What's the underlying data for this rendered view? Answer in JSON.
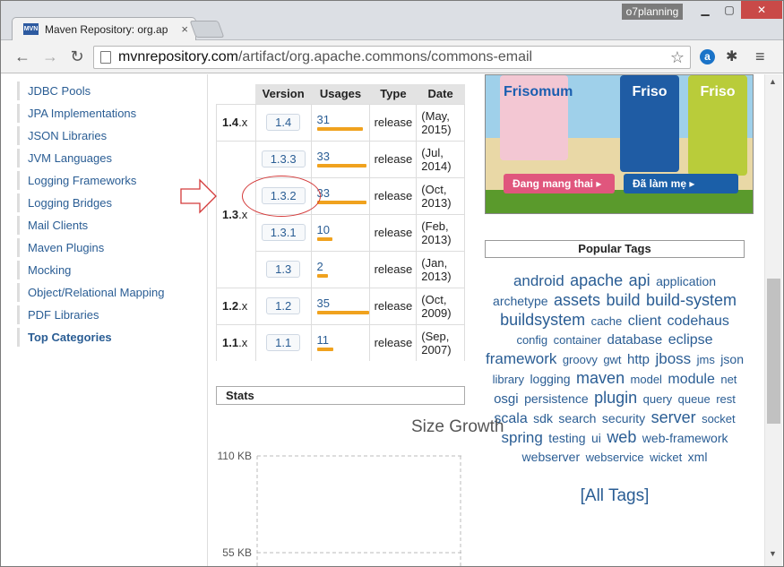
{
  "browser": {
    "tab_title": "Maven Repository: org.ap",
    "favicon_text": "MVN",
    "close_glyph": "×",
    "user_label": "o7planning",
    "url_host": "mvnrepository.com",
    "url_path": "/artifact/org.apache.commons/commons-email"
  },
  "sidebar": {
    "items": [
      "JDBC Pools",
      "JPA Implementations",
      "JSON Libraries",
      "JVM Languages",
      "Logging Frameworks",
      "Logging Bridges",
      "Mail Clients",
      "Maven Plugins",
      "Mocking",
      "Object/Relational Mapping",
      "PDF Libraries",
      "Top Categories"
    ]
  },
  "versions": {
    "headers": {
      "version": "Version",
      "usages": "Usages",
      "type": "Type",
      "date": "Date"
    },
    "rows": [
      {
        "minor": "1.4",
        "version": "1.4",
        "usages": "31",
        "type": "release",
        "date_a": "(May,",
        "date_b": "2015)"
      },
      {
        "minor": "1.3",
        "version": "1.3.3",
        "usages": "33",
        "type": "release",
        "date_a": "(Jul,",
        "date_b": "2014)"
      },
      {
        "minor": "",
        "version": "1.3.2",
        "usages": "33",
        "type": "release",
        "date_a": "(Oct,",
        "date_b": "2013)"
      },
      {
        "minor": "",
        "version": "1.3.1",
        "usages": "10",
        "type": "release",
        "date_a": "(Feb,",
        "date_b": "2013)"
      },
      {
        "minor": "",
        "version": "1.3",
        "usages": "2",
        "type": "release",
        "date_a": "(Jan,",
        "date_b": "2013)"
      },
      {
        "minor": "1.2",
        "version": "1.2",
        "usages": "35",
        "type": "release",
        "date_a": "(Oct,",
        "date_b": "2009)"
      },
      {
        "minor": "1.1",
        "version": "1.1",
        "usages": "11",
        "type": "release",
        "date_a": "(Sep,",
        "date_b": "2007)"
      }
    ],
    "x_suffix": ".x"
  },
  "stats": {
    "title": "Stats"
  },
  "chart_data": {
    "type": "line",
    "title": "Size Growth",
    "yticks": [
      "110 KB",
      "55 KB"
    ],
    "ylim": [
      55,
      110
    ]
  },
  "ad": {
    "brand1": "Frisomum",
    "brand2": "Friso",
    "brand3": "Friso",
    "button1": "Đang mang thai ▸",
    "button2": "Đã làm mẹ ▸"
  },
  "popular_tags": {
    "title": "Popular Tags",
    "tags": [
      {
        "t": "android",
        "s": 17
      },
      {
        "t": "apache",
        "s": 18
      },
      {
        "t": "api",
        "s": 18
      },
      {
        "t": "application",
        "s": 14
      },
      {
        "t": "archetype",
        "s": 14
      },
      {
        "t": "assets",
        "s": 18
      },
      {
        "t": "build",
        "s": 18
      },
      {
        "t": "build-system",
        "s": 18
      },
      {
        "t": "buildsystem",
        "s": 18
      },
      {
        "t": "cache",
        "s": 13
      },
      {
        "t": "client",
        "s": 16
      },
      {
        "t": "codehaus",
        "s": 16
      },
      {
        "t": "config",
        "s": 13
      },
      {
        "t": "container",
        "s": 13
      },
      {
        "t": "database",
        "s": 15
      },
      {
        "t": "eclipse",
        "s": 16
      },
      {
        "t": "framework",
        "s": 17
      },
      {
        "t": "groovy",
        "s": 13
      },
      {
        "t": "gwt",
        "s": 13
      },
      {
        "t": "http",
        "s": 15
      },
      {
        "t": "jboss",
        "s": 17
      },
      {
        "t": "jms",
        "s": 13
      },
      {
        "t": "json",
        "s": 14
      },
      {
        "t": "library",
        "s": 13
      },
      {
        "t": "logging",
        "s": 14
      },
      {
        "t": "maven",
        "s": 18
      },
      {
        "t": "model",
        "s": 13
      },
      {
        "t": "module",
        "s": 16
      },
      {
        "t": "net",
        "s": 13
      },
      {
        "t": "osgi",
        "s": 15
      },
      {
        "t": "persistence",
        "s": 14
      },
      {
        "t": "plugin",
        "s": 18
      },
      {
        "t": "query",
        "s": 13
      },
      {
        "t": "queue",
        "s": 13
      },
      {
        "t": "rest",
        "s": 13
      },
      {
        "t": "scala",
        "s": 16
      },
      {
        "t": "sdk",
        "s": 14
      },
      {
        "t": "search",
        "s": 14
      },
      {
        "t": "security",
        "s": 14
      },
      {
        "t": "server",
        "s": 18
      },
      {
        "t": "socket",
        "s": 13
      },
      {
        "t": "spring",
        "s": 17
      },
      {
        "t": "testing",
        "s": 14
      },
      {
        "t": "ui",
        "s": 14
      },
      {
        "t": "web",
        "s": 18
      },
      {
        "t": "web-framework",
        "s": 14
      },
      {
        "t": "webserver",
        "s": 14
      },
      {
        "t": "webservice",
        "s": 13
      },
      {
        "t": "wicket",
        "s": 13
      },
      {
        "t": "xml",
        "s": 14
      }
    ],
    "all_tags": "[All Tags]"
  }
}
